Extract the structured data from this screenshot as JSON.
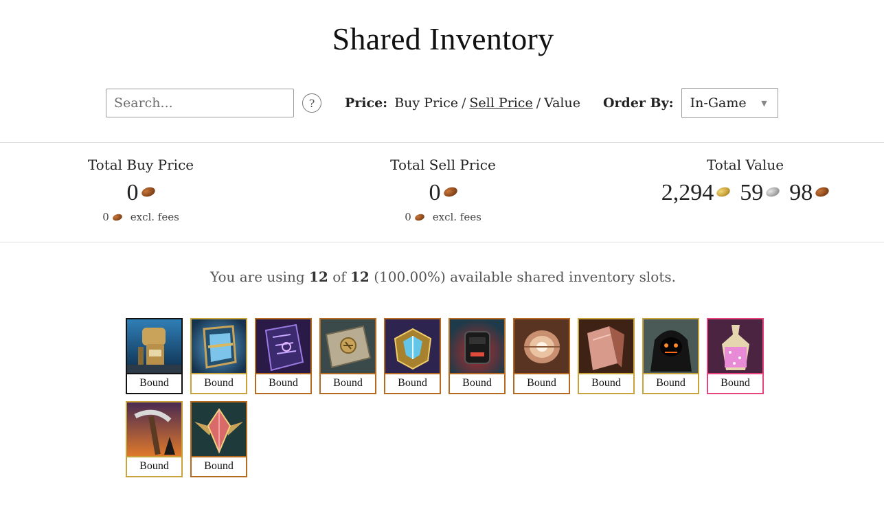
{
  "page": {
    "title": "Shared Inventory"
  },
  "search": {
    "placeholder": "Search..."
  },
  "help": {
    "label": "?"
  },
  "price": {
    "label": "Price:",
    "options": [
      "Buy Price",
      "Sell Price",
      "Value"
    ],
    "active": "Sell Price"
  },
  "order": {
    "label": "Order By:",
    "selected": "In-Game"
  },
  "totals": {
    "buy": {
      "label": "Total Buy Price",
      "amount": "0",
      "fees_amount": "0",
      "fees_label": "excl. fees"
    },
    "sell": {
      "label": "Total Sell Price",
      "amount": "0",
      "fees_amount": "0",
      "fees_label": "excl. fees"
    },
    "value": {
      "label": "Total Value",
      "gold": "2,294",
      "silver": "59",
      "copper": "98"
    }
  },
  "usage": {
    "prefix": "You are using",
    "used": "12",
    "mid": "of",
    "total": "12",
    "suffix": "(100.00%) available shared inventory slots."
  },
  "colors": {
    "gold_coin": "#c9a23a",
    "silver_coin": "#a9a9a9",
    "copper_coin": "#8f4a1c",
    "rarity_black": "#111111",
    "rarity_gold": "#c8a23a",
    "rarity_orange": "#b56a1f",
    "rarity_pink": "#e8437d"
  },
  "slots": [
    {
      "label": "Bound",
      "icon": "golem-statue-icon",
      "rarity": "black"
    },
    {
      "label": "Bound",
      "icon": "blue-banner-shield-icon",
      "rarity": "gold"
    },
    {
      "label": "Bound",
      "icon": "purple-rune-tome-icon",
      "rarity": "orange"
    },
    {
      "label": "Bound",
      "icon": "sealed-scroll-icon",
      "rarity": "orange"
    },
    {
      "label": "Bound",
      "icon": "golden-crystal-box-icon",
      "rarity": "orange"
    },
    {
      "label": "Bound",
      "icon": "red-glowing-pack-icon",
      "rarity": "orange"
    },
    {
      "label": "Bound",
      "icon": "copper-spool-icon",
      "rarity": "orange"
    },
    {
      "label": "Bound",
      "icon": "pink-cloth-bundle-icon",
      "rarity": "gold"
    },
    {
      "label": "Bound",
      "icon": "hooded-shadow-icon",
      "rarity": "gold"
    },
    {
      "label": "Bound",
      "icon": "sparkle-tonic-icon",
      "rarity": "pink"
    },
    {
      "label": "Bound",
      "icon": "sickle-sunset-icon",
      "rarity": "gold"
    },
    {
      "label": "Bound",
      "icon": "winged-gem-icon",
      "rarity": "orange"
    }
  ]
}
